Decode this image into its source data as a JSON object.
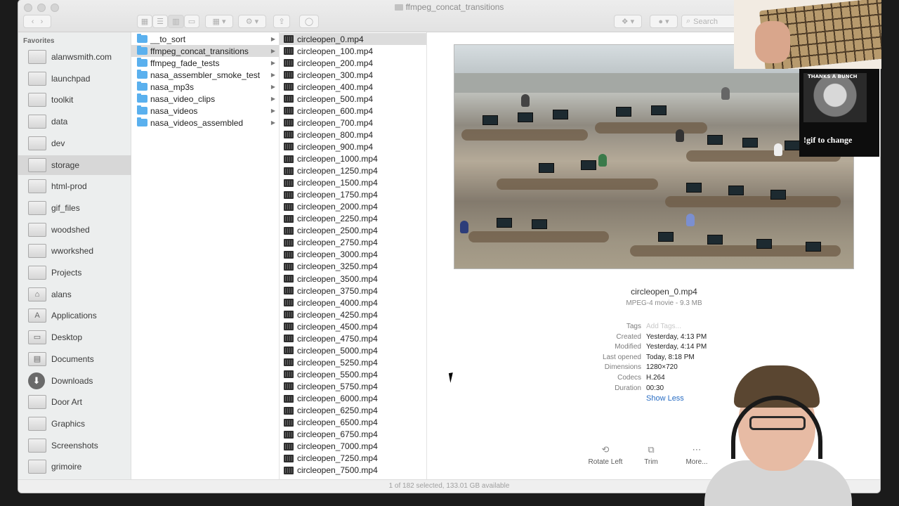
{
  "window": {
    "title": "ffmpeg_concat_transitions"
  },
  "toolbar": {
    "search_placeholder": "Search"
  },
  "sidebar": {
    "header": "Favorites",
    "items": [
      {
        "label": "alanwsmith.com",
        "icon": "folder-icon"
      },
      {
        "label": "launchpad",
        "icon": "folder-icon"
      },
      {
        "label": "toolkit",
        "icon": "folder-icon"
      },
      {
        "label": "data",
        "icon": "folder-icon"
      },
      {
        "label": "dev",
        "icon": "folder-icon"
      },
      {
        "label": "storage",
        "icon": "folder-icon",
        "selected": true
      },
      {
        "label": "html-prod",
        "icon": "folder-icon"
      },
      {
        "label": "gif_files",
        "icon": "folder-icon"
      },
      {
        "label": "woodshed",
        "icon": "folder-icon"
      },
      {
        "label": "wworkshed",
        "icon": "folder-icon"
      },
      {
        "label": "Projects",
        "icon": "folder-icon"
      },
      {
        "label": "alans",
        "icon": "home-icon"
      },
      {
        "label": "Applications",
        "icon": "applications-icon"
      },
      {
        "label": "Desktop",
        "icon": "desktop-icon"
      },
      {
        "label": "Documents",
        "icon": "documents-icon"
      },
      {
        "label": "Downloads",
        "icon": "downloads-icon"
      },
      {
        "label": "Door Art",
        "icon": "folder-icon"
      },
      {
        "label": "Graphics",
        "icon": "folder-icon"
      },
      {
        "label": "Screenshots",
        "icon": "folder-icon"
      },
      {
        "label": "grimoire",
        "icon": "folder-icon"
      }
    ]
  },
  "column1": {
    "items": [
      {
        "label": "__to_sort"
      },
      {
        "label": "ffmpeg_concat_transitions",
        "selected": true
      },
      {
        "label": "ffmpeg_fade_tests"
      },
      {
        "label": "nasa_assembler_smoke_test"
      },
      {
        "label": "nasa_mp3s"
      },
      {
        "label": "nasa_video_clips"
      },
      {
        "label": "nasa_videos"
      },
      {
        "label": "nasa_videos_assembled"
      }
    ]
  },
  "column2": {
    "items": [
      "circleopen_0.mp4",
      "circleopen_100.mp4",
      "circleopen_200.mp4",
      "circleopen_300.mp4",
      "circleopen_400.mp4",
      "circleopen_500.mp4",
      "circleopen_600.mp4",
      "circleopen_700.mp4",
      "circleopen_800.mp4",
      "circleopen_900.mp4",
      "circleopen_1000.mp4",
      "circleopen_1250.mp4",
      "circleopen_1500.mp4",
      "circleopen_1750.mp4",
      "circleopen_2000.mp4",
      "circleopen_2250.mp4",
      "circleopen_2500.mp4",
      "circleopen_2750.mp4",
      "circleopen_3000.mp4",
      "circleopen_3250.mp4",
      "circleopen_3500.mp4",
      "circleopen_3750.mp4",
      "circleopen_4000.mp4",
      "circleopen_4250.mp4",
      "circleopen_4500.mp4",
      "circleopen_4750.mp4",
      "circleopen_5000.mp4",
      "circleopen_5250.mp4",
      "circleopen_5500.mp4",
      "circleopen_5750.mp4",
      "circleopen_6000.mp4",
      "circleopen_6250.mp4",
      "circleopen_6500.mp4",
      "circleopen_6750.mp4",
      "circleopen_7000.mp4",
      "circleopen_7250.mp4",
      "circleopen_7500.mp4"
    ],
    "selected_index": 0
  },
  "preview": {
    "filename": "circleopen_0.mp4",
    "subtitle": "MPEG-4 movie - 9.3 MB",
    "meta": [
      {
        "key": "Tags",
        "value": "Add Tags...",
        "placeholder": true
      },
      {
        "key": "Created",
        "value": "Yesterday, 4:13 PM"
      },
      {
        "key": "Modified",
        "value": "Yesterday, 4:14 PM"
      },
      {
        "key": "Last opened",
        "value": "Today, 8:18 PM"
      },
      {
        "key": "Dimensions",
        "value": "1280×720"
      },
      {
        "key": "Codecs",
        "value": "H.264"
      },
      {
        "key": "Duration",
        "value": "00:30"
      }
    ],
    "show_less": "Show Less",
    "actions": [
      {
        "label": "Rotate Left",
        "icon": "rotate-left-icon"
      },
      {
        "label": "Trim",
        "icon": "trim-icon"
      },
      {
        "label": "More...",
        "icon": "more-icon"
      }
    ]
  },
  "status": "1 of 182 selected, 133.01 GB available",
  "overlay": {
    "gif_caption_top": "THANKS A BUNCH",
    "gif_caption": "!gif to change"
  }
}
